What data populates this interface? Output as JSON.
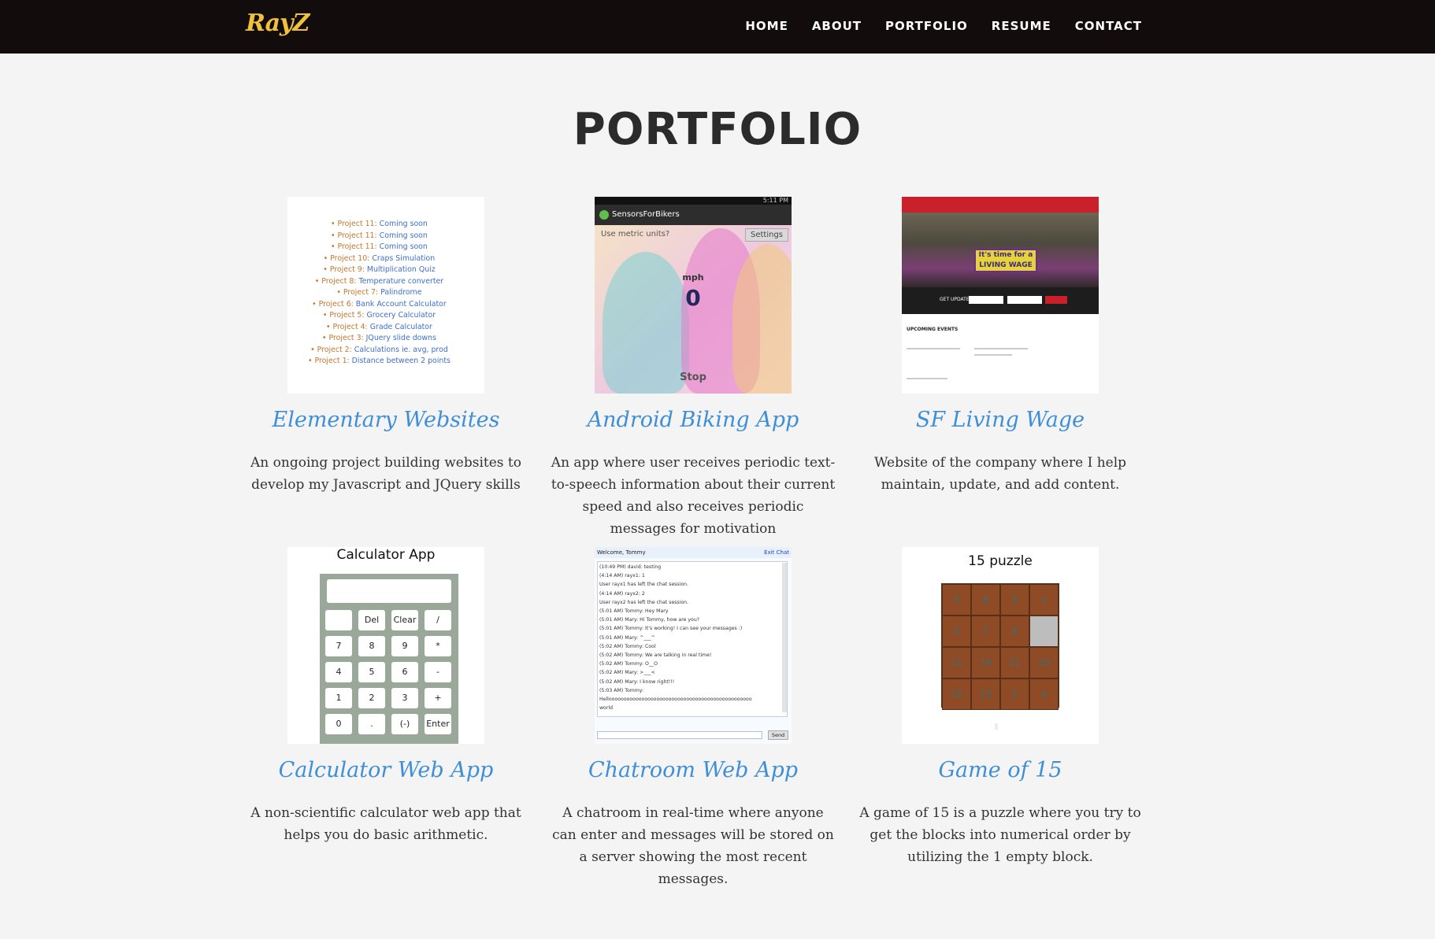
{
  "brand": {
    "logo": "RayZ"
  },
  "nav": {
    "items": [
      "HOME",
      "ABOUT",
      "PORTFOLIO",
      "RESUME",
      "CONTACT"
    ]
  },
  "section": {
    "title": "PORTFOLIO"
  },
  "projects": [
    {
      "title": "Elementary Websites",
      "description": "An ongoing project building websites to develop my Javascript and JQuery skills"
    },
    {
      "title": "Android Biking App",
      "description": "An app where user receives periodic text-to-speech information about their current speed and also receives periodic messages for motivation"
    },
    {
      "title": "SF Living Wage",
      "description": "Website of the company where I help maintain, update, and add content."
    },
    {
      "title": "Calculator Web App",
      "description": "A non-scientific calculator web app that helps you do basic arithmetic."
    },
    {
      "title": "Chatroom Web App",
      "description": "A chatroom in real-time where anyone can enter and messages will be stored on a server showing the most recent messages."
    },
    {
      "title": "Game of 15",
      "description": "A game of 15 is a puzzle where you try to get the blocks into numerical order by utilizing the 1 empty block."
    }
  ],
  "thumbs": {
    "elementary": {
      "items": [
        {
          "label": "Project 11:",
          "text": "Coming soon"
        },
        {
          "label": "Project 11:",
          "text": "Coming soon"
        },
        {
          "label": "Project 11:",
          "text": "Coming soon"
        },
        {
          "label": "Project 10:",
          "text": "Craps Simulation"
        },
        {
          "label": "Project 9:",
          "text": "Multiplication Quiz"
        },
        {
          "label": "Project 8:",
          "text": "Temperature converter"
        },
        {
          "label": "Project 7:",
          "text": "Palindrome"
        },
        {
          "label": "Project 6:",
          "text": "Bank Account Calculator"
        },
        {
          "label": "Project 5:",
          "text": "Grocery Calculator"
        },
        {
          "label": "Project 4:",
          "text": "Grade Calculator"
        },
        {
          "label": "Project 3:",
          "text": "JQuery slide downs"
        },
        {
          "label": "Project 2:",
          "text": "Calculations ie. avg, prod"
        },
        {
          "label": "Project 1:",
          "text": "Distance between 2 points"
        }
      ]
    },
    "biking": {
      "status_time": "5:11 PM",
      "app_name": "SensorsForBikers",
      "metric_label": "Use metric units?",
      "settings_label": "Settings",
      "unit": "mph",
      "speed": "0",
      "stop_label": "Stop"
    },
    "wage": {
      "banner": "It's time for a LIVING WAGE",
      "get_updates": "GET UPDATES",
      "upcoming": "UPCOMING EVENTS"
    },
    "calculator": {
      "title": "Calculator App",
      "keys": [
        "",
        "Del",
        "Clear",
        "/",
        "7",
        "8",
        "9",
        "*",
        "4",
        "5",
        "6",
        "-",
        "1",
        "2",
        "3",
        "+",
        "0",
        ".",
        "(-)",
        "Enter"
      ]
    },
    "chat": {
      "welcome": "Welcome, Tommy",
      "exit": "Exit Chat",
      "lines": [
        "(10:49 PM) david: testing",
        "(4:14 AM) rayx1: 1",
        "User rayx1 has left the chat session.",
        "(4:14 AM) rayx2: 2",
        "User rayx2 has left the chat session.",
        "(5:01 AM) Tommy: Hey Mary",
        "(5:01 AM) Mary: Hi Tommy, how are you?",
        "(5:01 AM) Tommy: It's working! I can see your messages :)",
        "(5:01 AM) Mary: ^___^",
        "(5:02 AM) Tommy: Cool",
        "(5:02 AM) Tommy: We are talking in real time!",
        "(5:02 AM) Tommy: O__O",
        "(5:02 AM) Mary: >___<",
        "(5:02 AM) Mary: I know right!!!",
        "(5:03 AM) Tommy:",
        "Helloooooooooooooooooooooooooooooooooooooooooooooooo",
        "world"
      ],
      "send_label": "Send"
    },
    "puzzle": {
      "title": "15 puzzle",
      "tiles": [
        "5",
        "8",
        "9",
        "1",
        "3",
        "7",
        "6",
        "",
        "12",
        "14",
        "11",
        "10",
        "15",
        "13",
        "2",
        "4"
      ]
    }
  }
}
